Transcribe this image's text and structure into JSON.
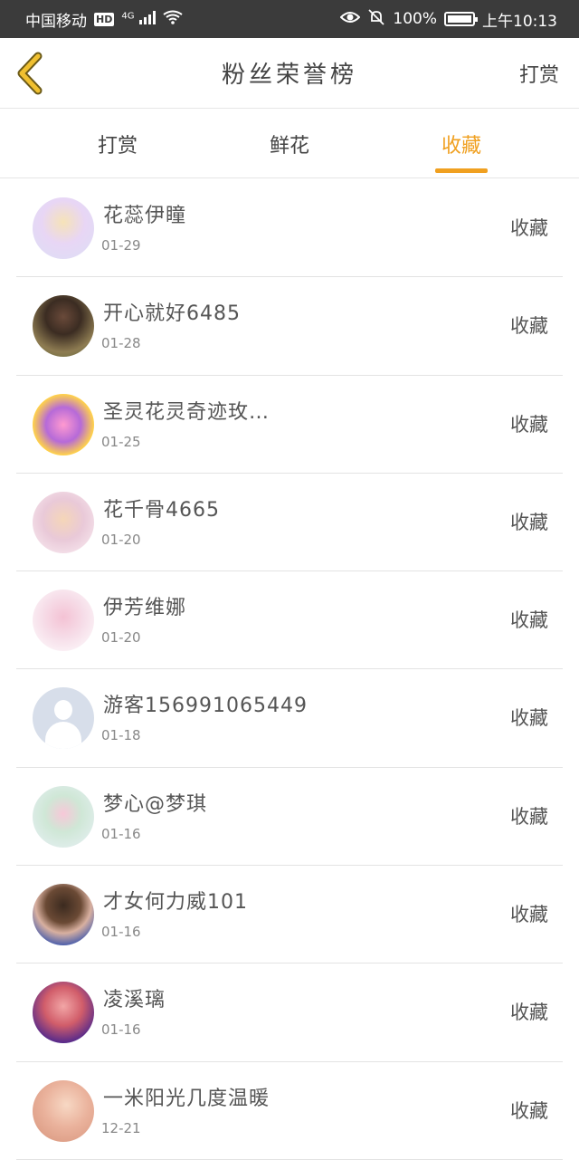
{
  "status_bar": {
    "carrier": "中国移动",
    "network_badge": "HD",
    "network_type": "4G",
    "battery_percent": "100%",
    "time": "上午10:13"
  },
  "nav": {
    "title": "粉丝荣誉榜",
    "right_action": "打赏"
  },
  "tabs": [
    {
      "label": "打赏",
      "active": false
    },
    {
      "label": "鲜花",
      "active": false
    },
    {
      "label": "收藏",
      "active": true
    }
  ],
  "fans": [
    {
      "name": "花蕊伊瞳",
      "date": "01-29",
      "tag": "收藏"
    },
    {
      "name": "开心就好6485",
      "date": "01-28",
      "tag": "收藏"
    },
    {
      "name": "圣灵花灵奇迹玫…",
      "date": "01-25",
      "tag": "收藏"
    },
    {
      "name": "花千骨4665",
      "date": "01-20",
      "tag": "收藏"
    },
    {
      "name": "伊芳维娜",
      "date": "01-20",
      "tag": "收藏"
    },
    {
      "name": "游客156991065449",
      "date": "01-18",
      "tag": "收藏"
    },
    {
      "name": "梦心@梦琪",
      "date": "01-16",
      "tag": "收藏"
    },
    {
      "name": "才女何力威101",
      "date": "01-16",
      "tag": "收藏"
    },
    {
      "name": "凌溪璃",
      "date": "01-16",
      "tag": "收藏"
    },
    {
      "name": "一米阳光几度温暖",
      "date": "12-21",
      "tag": "收藏"
    }
  ],
  "colors": {
    "accent": "#f0a020",
    "status_bar_bg": "#3b3b3b",
    "text": "#555555"
  }
}
